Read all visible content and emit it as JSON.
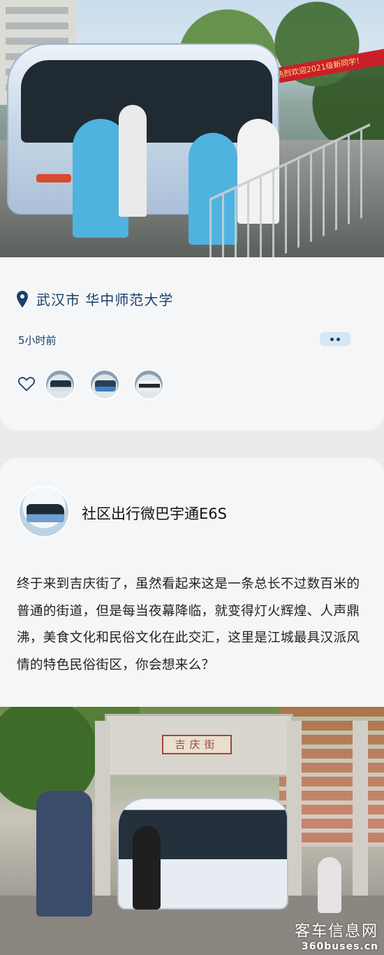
{
  "photo_top": {
    "alt": "",
    "banner_text": "热烈欢迎2021级新同学！"
  },
  "location_card": {
    "location": "武汉市  华中师范大学",
    "time_ago": "5小时前"
  },
  "post": {
    "title": "社区出行微巴宇通E6S",
    "body": "终于来到吉庆街了，虽然看起来这是一条总长不过数百米的普通的街道，但是每当夜幕降临，就变得灯火辉煌、人声鼎沸，美食文化和民俗文化在此交汇，这里是江城最具汉派风情的特色民俗街区，你会想来么？"
  },
  "photo_bottom": {
    "plaque_text": "吉庆街"
  },
  "watermark": {
    "line1": "客车信息网",
    "line2": "360buses.cn"
  },
  "colors": {
    "accent": "#1a3f6b",
    "more_button_bg": "#d5e6f5",
    "card_bg": "#f5f6f7",
    "page_bg": "#e9ebed"
  }
}
